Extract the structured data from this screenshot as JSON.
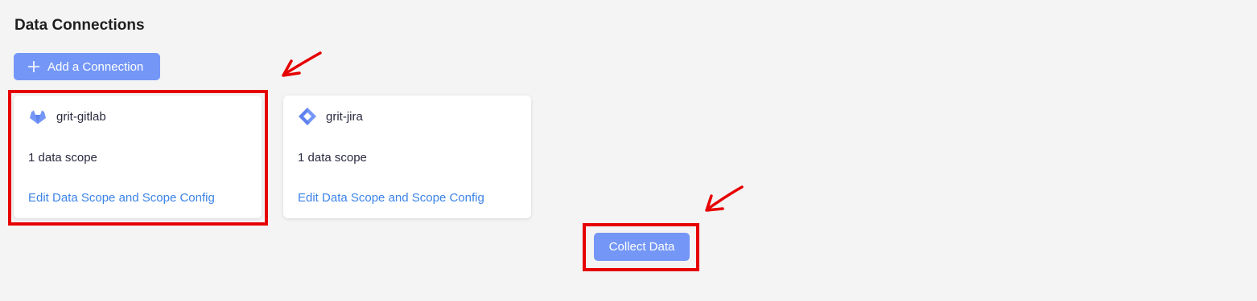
{
  "page": {
    "title": "Data Connections"
  },
  "toolbar": {
    "add_connection_label": "Add a Connection",
    "add_icon": "plus-icon"
  },
  "connections": [
    {
      "name": "grit-gitlab",
      "icon": "gitlab-icon",
      "scope": "1 data scope",
      "link": "Edit Data Scope and Scope Config"
    },
    {
      "name": "grit-jira",
      "icon": "jira-icon",
      "scope": "1 data scope",
      "link": "Edit Data Scope and Scope Config"
    }
  ],
  "actions": {
    "collect_label": "Collect Data"
  },
  "colors": {
    "primary": "#7497f7",
    "link": "#3b83e8",
    "annotation": "#e60000",
    "background": "#f4f4f4"
  }
}
